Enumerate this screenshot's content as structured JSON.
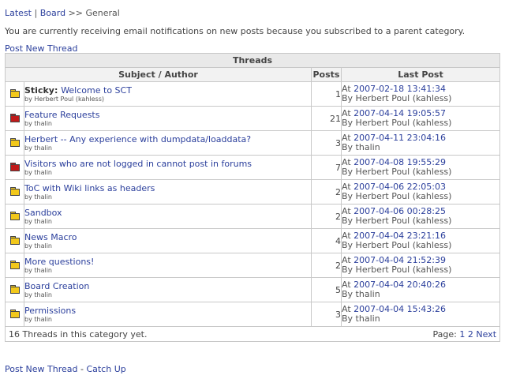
{
  "breadcrumb": {
    "latest": "Latest",
    "sep1": "|",
    "board": "Board",
    "sep2": ">>",
    "current": "General"
  },
  "notice": "You are currently receiving email notifications on new posts because you subscribed to a parent category.",
  "post_new_thread_top": "Post New Thread",
  "table": {
    "caption": "Threads",
    "columns": [
      "Subject / Author",
      "Posts",
      "Last Post"
    ],
    "rows": [
      {
        "folder": "yellow",
        "prefix": "Sticky: ",
        "subject": "Welcome to SCT",
        "author": "by Herbert Poul (kahless)",
        "posts": "1",
        "at": "At ",
        "date": "2007-02-18 13:41:34",
        "by": "By Herbert Poul (kahless)"
      },
      {
        "folder": "red",
        "prefix": "",
        "subject": "Feature Requests",
        "author": "by thalin",
        "posts": "21",
        "at": "At ",
        "date": "2007-04-14 19:05:57",
        "by": "By Herbert Poul (kahless)"
      },
      {
        "folder": "yellow",
        "prefix": "",
        "subject": "Herbert -- Any experience with dumpdata/loaddata?",
        "author": "by thalin",
        "posts": "3",
        "at": "At ",
        "date": "2007-04-11 23:04:16",
        "by": "By thalin"
      },
      {
        "folder": "red",
        "prefix": "",
        "subject": "Visitors who are not logged in cannot post in forums",
        "author": "by thalin",
        "posts": "7",
        "at": "At ",
        "date": "2007-04-08 19:55:29",
        "by": "By Herbert Poul (kahless)"
      },
      {
        "folder": "yellow",
        "prefix": "",
        "subject": "ToC with Wiki links as headers",
        "author": "by thalin",
        "posts": "2",
        "at": "At ",
        "date": "2007-04-06 22:05:03",
        "by": "By Herbert Poul (kahless)"
      },
      {
        "folder": "yellow",
        "prefix": "",
        "subject": "Sandbox",
        "author": "by thalin",
        "posts": "2",
        "at": "At ",
        "date": "2007-04-06 00:28:25",
        "by": "By Herbert Poul (kahless)"
      },
      {
        "folder": "yellow",
        "prefix": "",
        "subject": "News Macro",
        "author": "by thalin",
        "posts": "4",
        "at": "At ",
        "date": "2007-04-04 23:21:16",
        "by": "By Herbert Poul (kahless)"
      },
      {
        "folder": "yellow",
        "prefix": "",
        "subject": "More questions!",
        "author": "by thalin",
        "posts": "2",
        "at": "At ",
        "date": "2007-04-04 21:52:39",
        "by": "By Herbert Poul (kahless)"
      },
      {
        "folder": "yellow",
        "prefix": "",
        "subject": "Board Creation",
        "author": "by thalin",
        "posts": "5",
        "at": "At ",
        "date": "2007-04-04 20:40:26",
        "by": "By thalin"
      },
      {
        "folder": "yellow",
        "prefix": "",
        "subject": "Permissions",
        "author": "by thalin",
        "posts": "3",
        "at": "At ",
        "date": "2007-04-04 15:43:26",
        "by": "By thalin"
      }
    ],
    "footer": {
      "count_text": "16 Threads in this category yet.",
      "page_label": "Page: ",
      "pages": [
        "1",
        "2"
      ],
      "next": "Next"
    }
  },
  "bottom": {
    "post_new_thread": "Post New Thread",
    "sep": " - ",
    "catch_up": "Catch Up"
  },
  "colors": {
    "link": "#2b3f9c",
    "folder_yellow": "#f2c81a",
    "folder_red": "#c11a1a",
    "header_bg": "#e9e9e9"
  }
}
